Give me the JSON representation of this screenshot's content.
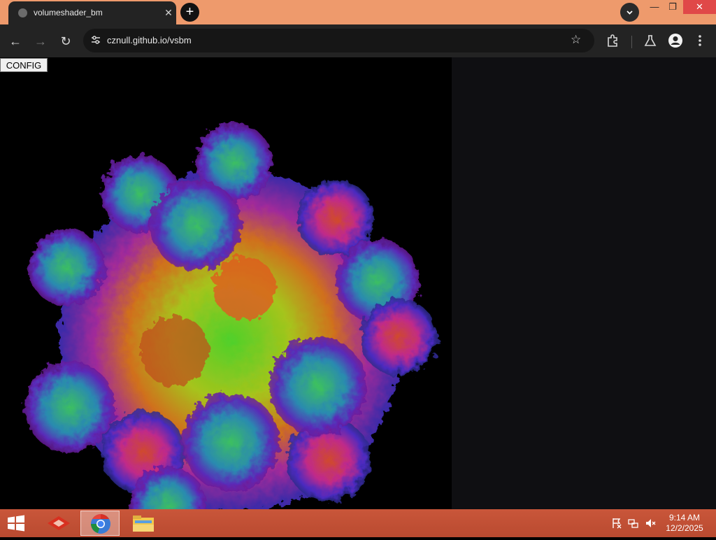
{
  "browser": {
    "tab": {
      "title": "volumeshader_bm",
      "close_glyph": "✕",
      "favicon": "globe-icon"
    },
    "new_tab_glyph": "+",
    "window_controls": {
      "minimize": "—",
      "maximize": "❐",
      "close": "✕"
    },
    "toolbar": {
      "back": "←",
      "forward": "→",
      "reload": "↻",
      "star": "☆"
    },
    "address": {
      "url": "cznull.github.io/vsbm"
    }
  },
  "page": {
    "config_button": "CONFIG",
    "canvas_description_icon": "fractal-render",
    "right_pane_color": "#0f0f12"
  },
  "taskbar": {
    "clock": {
      "time": "9:14 AM",
      "date": "12/2/2025"
    },
    "apps": [
      "app-icon",
      "chrome-icon",
      "file-explorer-icon"
    ]
  },
  "colors": {
    "tabstrip": "#ee9a6c",
    "toolbar": "#232323",
    "taskbar": "#c25035"
  }
}
